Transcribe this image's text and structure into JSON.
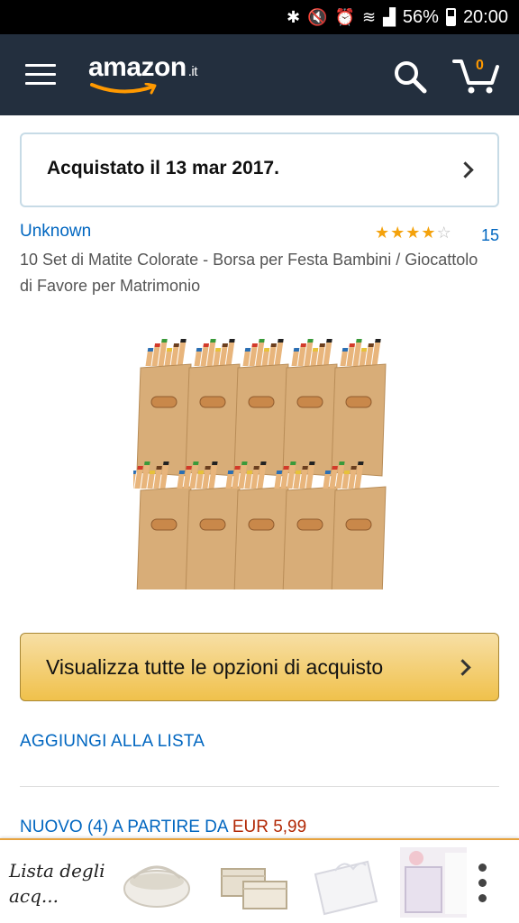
{
  "status_bar": {
    "icons": [
      "bluetooth-icon",
      "mute-icon",
      "alarm-icon",
      "wifi-icon",
      "signal-icon"
    ],
    "battery": "56%",
    "time": "20:00"
  },
  "header": {
    "logo_text": "amazon",
    "logo_tld": ".it",
    "cart_count": "0",
    "brand_color": "#232f3e",
    "accent_color": "#ff9900"
  },
  "purchase_notice": {
    "text": "Acquistato il 13 mar 2017."
  },
  "product": {
    "brand": "Unknown",
    "rating": 4,
    "rating_max": 5,
    "review_count": "15",
    "title": "10 Set di Matite Colorate - Borsa per Festa Bambini / Giocattolo di Favore per Matrimonio"
  },
  "actions": {
    "view_options": "Visualizza tutte le opzioni di acquisto",
    "add_to_list": "AGGIUNGI ALLA LISTA"
  },
  "offers": {
    "text": "NUOVO (4) A PARTIRE DA ",
    "price": "EUR 5,99"
  },
  "bottom_bar": {
    "label": "Lista degli acq...",
    "thumbnails": [
      "basket-thumbnail",
      "baskets-thumbnail",
      "place-card-thumbnail",
      "favor-box-thumbnail"
    ]
  }
}
